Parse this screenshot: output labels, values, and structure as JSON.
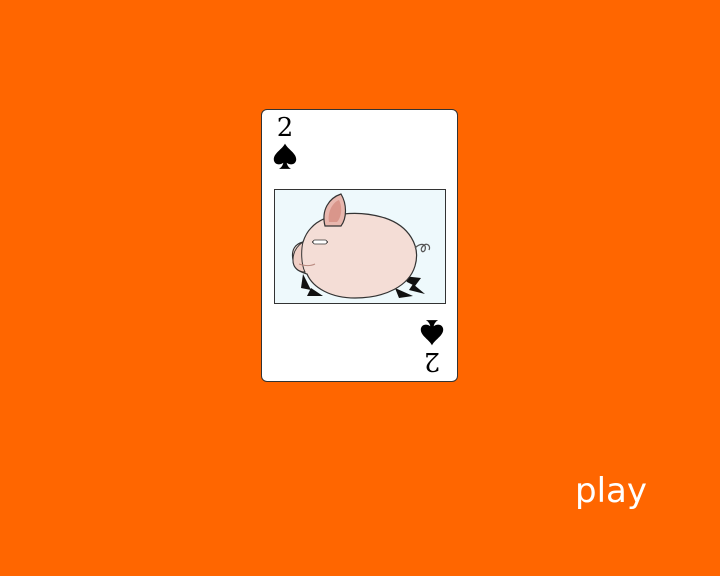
{
  "background_color": "#ff6600",
  "card": {
    "rank": "2",
    "suit": "spades",
    "suit_icon": "spade-icon",
    "illustration": "pig-illustration",
    "face_color": "#ffffff",
    "art_background": "#eef9fc"
  },
  "controls": {
    "play_label": "play",
    "play_color": "#ffffff"
  }
}
